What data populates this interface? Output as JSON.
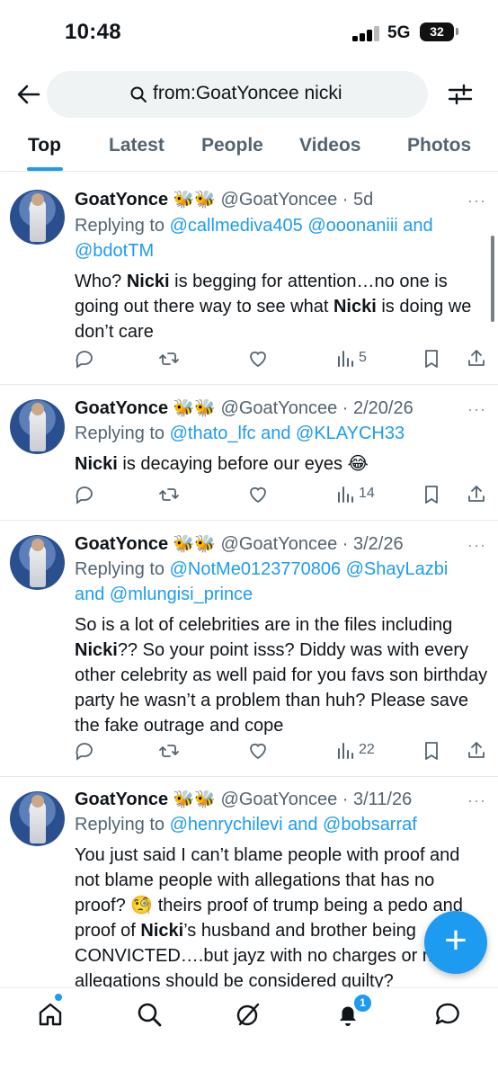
{
  "status_bar": {
    "time": "10:48",
    "network": "5G",
    "battery": "32"
  },
  "search": {
    "query": "from:GoatYoncee nicki"
  },
  "tabs": [
    {
      "label": "Top",
      "active": true
    },
    {
      "label": "Latest",
      "active": false
    },
    {
      "label": "People",
      "active": false
    },
    {
      "label": "Videos",
      "active": false
    },
    {
      "label": "Photos",
      "active": false
    }
  ],
  "tweets": [
    {
      "name": "GoatYonce",
      "emojis": "🐝🐝",
      "handle_date": "@GoatYoncee · 5d",
      "replying_to_label": "Replying to",
      "mentions_line1": "@callmediva405 @ooonaniii and",
      "mentions_line2": "@bdotTM",
      "text_a": "Who? ",
      "bold_a": "Nicki",
      "text_b": " is begging for attention…no one is going out there way to see what ",
      "bold_b": "Nicki",
      "text_c": " is doing we don’t care",
      "views": "5",
      "more": "···"
    },
    {
      "name": "GoatYonce",
      "emojis": "🐝🐝",
      "handle_date": "@GoatYoncee · 2/20/26",
      "replying_to_label": "Replying to",
      "mentions_line1": "@thato_lfc and @KLAYCH33",
      "bold_a": "Nicki",
      "text_b": " is decaying before our eyes 😂",
      "views": "14",
      "more": "···"
    },
    {
      "name": "GoatYonce",
      "emojis": "🐝🐝",
      "handle_date": "@GoatYoncee · 3/2/26",
      "replying_to_label": "Replying to",
      "mentions_line1": "@NotMe0123770806 @ShayLazbi",
      "mentions_line2": "and @mlungisi_prince",
      "text_a": "So is a lot of celebrities are in the files including ",
      "bold_a": "Nicki",
      "text_b": "?? So your point isss? Diddy was with every other celebrity as well paid for you favs son birthday party he wasn’t a problem than huh? Please save the fake outrage and cope",
      "views": "22",
      "more": "···"
    },
    {
      "name": "GoatYonce",
      "emojis": "🐝🐝",
      "handle_date": "@GoatYoncee · 3/11/26",
      "replying_to_label": "Replying to",
      "mentions_line1": "@henrychilevi and @bobsarraf",
      "text_a": "You just said I can’t blame people with proof and not blame people with allegations that has no proof? 🧐 theirs proof of trump being a pedo and proof of ",
      "bold_a": "Nicki",
      "text_b": "’s husband and brother being CONVICTED….but jayz with no charges or no allegations should be considered guilty?",
      "more": "···"
    }
  ],
  "compose_label": "+",
  "nav": {
    "notifications_count": "1"
  },
  "colors": {
    "accent": "#1d9bf0",
    "muted": "#536471",
    "text": "#0f1419"
  }
}
